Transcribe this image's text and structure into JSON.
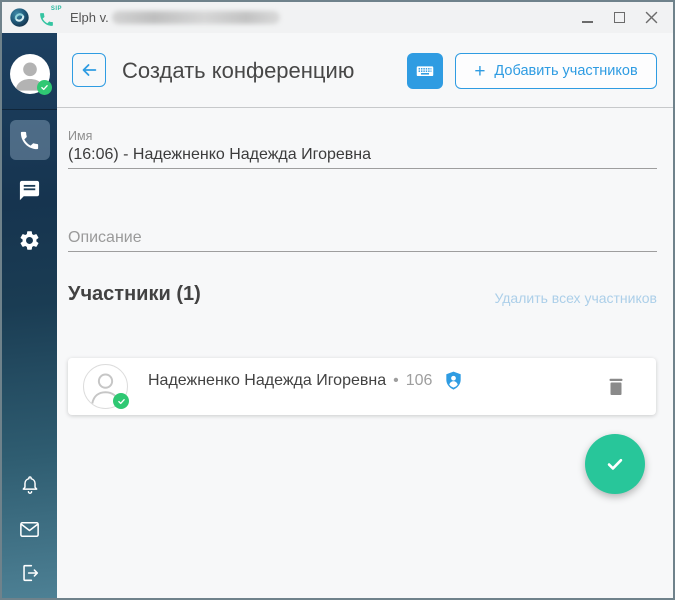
{
  "titlebar": {
    "app_title": "Elph v.",
    "sip_badge": "SIP"
  },
  "header": {
    "title": "Создать конференцию",
    "add_participants": {
      "plus": "+",
      "label": "Добавить участников"
    }
  },
  "form": {
    "name_label": "Имя",
    "name_value": "(16:06) - Надежненко Надежда Игоревна",
    "description_placeholder": "Описание"
  },
  "participants": {
    "heading": "Участники (1)",
    "remove_all": "Удалить всех участников",
    "list": [
      {
        "name": "Надежненко Надежда Игоревна",
        "bullet": "•",
        "extension": "106"
      }
    ]
  },
  "colors": {
    "accent_blue": "#2f9ce2",
    "fab_green": "#28c69a",
    "badge_green": "#2fc873",
    "sidebar_top": "#1d4061",
    "sidebar_bottom": "#4d8094",
    "muted_link_blue": "#accfe9"
  },
  "icons": {
    "app_logo": "swirl-circle",
    "sip_phone": "phone-handset",
    "minimize": "bar",
    "maximize": "square",
    "close": "x",
    "sidebar": [
      "phone",
      "chat",
      "gear",
      "bell",
      "mail",
      "logout"
    ],
    "header": [
      "back-arrow",
      "keyboard",
      "plus"
    ],
    "participant": [
      "person-avatar",
      "check-badge",
      "shield-person",
      "trash"
    ],
    "fab": "checkmark"
  }
}
